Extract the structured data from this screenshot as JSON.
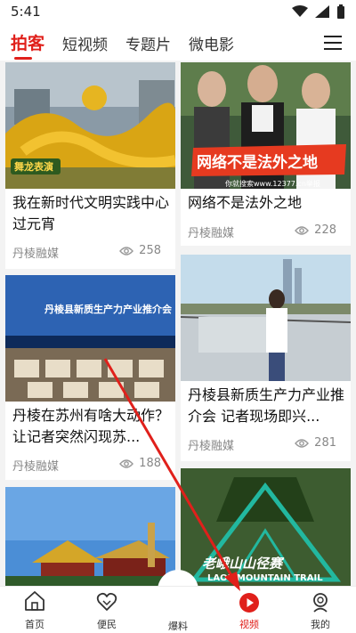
{
  "status_bar": {
    "time": "5:41"
  },
  "tabs": [
    {
      "label": "拍客",
      "active": true
    },
    {
      "label": "短视频",
      "active": false
    },
    {
      "label": "专题片",
      "active": false
    },
    {
      "label": "微电影",
      "active": false
    }
  ],
  "cards": [
    {
      "title": "我在新时代文明实践中心过元宵",
      "source": "丹棱融媒",
      "views": "258",
      "thumb_badge": "舞龙表演"
    },
    {
      "title": "网络不是法外之地",
      "source": "丹棱融媒",
      "views": "228",
      "thumb_caption": "网络不是法外之地",
      "thumb_small": "你就搜索www.12377.cn举报"
    },
    {
      "title": "丹棱在苏州有啥大动作？让记者突然闪现苏...",
      "source": "丹棱融媒",
      "views": "188",
      "thumb_banner": "丹棱县新质生产力产业推介会"
    },
    {
      "title": "丹棱县新质生产力产业推介会 记者现场即兴...",
      "source": "丹棱融媒",
      "views": "281"
    },
    {
      "title": "",
      "source": "",
      "views": ""
    },
    {
      "title": "",
      "source": "",
      "views": "",
      "thumb_caption": "老峨山山径赛",
      "thumb_small": "LAOE MOUNTAIN TRAIL"
    }
  ],
  "bottom_nav": [
    {
      "label": "首页",
      "icon": "home-icon"
    },
    {
      "label": "便民",
      "icon": "heart-icon"
    },
    {
      "label": "爆料",
      "icon": "camera-icon"
    },
    {
      "label": "视频",
      "icon": "video-play-icon",
      "active": true
    },
    {
      "label": "我的",
      "icon": "user-icon"
    }
  ],
  "colors": {
    "accent": "#e0201b",
    "source_text": "#888888",
    "background": "#f3f3f3"
  }
}
